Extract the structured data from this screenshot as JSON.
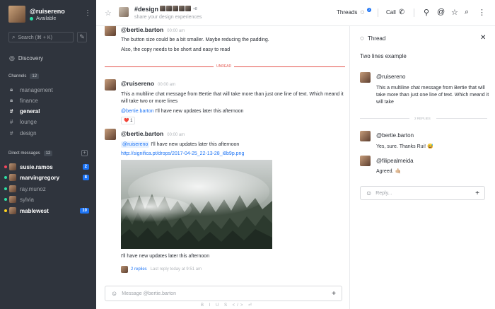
{
  "sidebar": {
    "user": {
      "name": "@ruisereno",
      "status": "Available",
      "status_color": "#2de0a5"
    },
    "search_placeholder": "Search (⌘ + K)",
    "discovery": "Discovery",
    "channels_title": "Channels",
    "channels_count": "12",
    "channels": [
      {
        "label": "management",
        "icon": "lock-icon"
      },
      {
        "label": "finance",
        "icon": "lock-icon"
      },
      {
        "label": "general",
        "icon": "hash-icon",
        "active": true
      },
      {
        "label": "lounge",
        "icon": "hash-icon"
      },
      {
        "label": "design",
        "icon": "hash-icon"
      }
    ],
    "dm_title": "Direct messages",
    "dm_count": "12",
    "dms": [
      {
        "label": "susie.ramos",
        "bold": true,
        "badge": "2",
        "status_color": "#f5455c"
      },
      {
        "label": "marvingregory",
        "bold": true,
        "badge": "8",
        "status_color": "#2de0a5"
      },
      {
        "label": "ray.munoz",
        "bold": false,
        "badge": "",
        "status_color": "#2de0a5"
      },
      {
        "label": "sylvia",
        "bold": false,
        "badge": "",
        "status_color": "#2de0a5"
      },
      {
        "label": "mablewest",
        "bold": true,
        "badge": "10",
        "status_color": "#ffd21f"
      }
    ]
  },
  "header": {
    "room_name": "#design",
    "member_more": "+8",
    "topic": "share your design experiences",
    "threads_label": "Threads",
    "threads_badge": "2",
    "call_label": "Call"
  },
  "messages": {
    "m1": {
      "user": "@bertie.barton",
      "time": "00:00 am",
      "lines": [
        "The button size could be a bit smaller. Maybe reducing the padding.",
        "Also, the copy needs to be short and easy to read"
      ]
    },
    "unread_label": "UNREAD",
    "m2": {
      "user": "@ruisereno",
      "time": "00:00 am",
      "text": "This a multiline chat message from Bertie that will take more than just one line of text. Which meand it will take two or more lines",
      "mention": "@bertie.barton",
      "after_mention": " I'll have new updates later this afternoon",
      "reaction": "❤️ 1"
    },
    "m3": {
      "user": "@bertie.barton",
      "time": "00:00 am",
      "mention": "@ruisereno",
      "after_mention": " I'll have new updates later this afternoon",
      "link": "http://significa.pt/drops/2017-04-25_22-13-28_i8b9p.png",
      "caption": "I'll have new updates later this afternoon",
      "replies": "2 replies",
      "last_reply": "Last reply today at 9:51 am"
    }
  },
  "composer": {
    "placeholder": "Message @bertie.barton",
    "formatting": "B I U S </> ⏎"
  },
  "thread": {
    "header": "Thread",
    "title": "Two lines example",
    "original": {
      "user": "@ruisereno",
      "text": "This a multiline chat message from Bertie that will take more than just one line of text. Which meand it will take"
    },
    "replies_label": "2 REPLIES",
    "replies": [
      {
        "user": "@bertie.barton",
        "text": "Yes, sure. Thanks Rui! 😅"
      },
      {
        "user": "@filipealmeida",
        "text": "Agreed. 🤙🏼"
      }
    ],
    "composer_placeholder": "Reply..."
  }
}
